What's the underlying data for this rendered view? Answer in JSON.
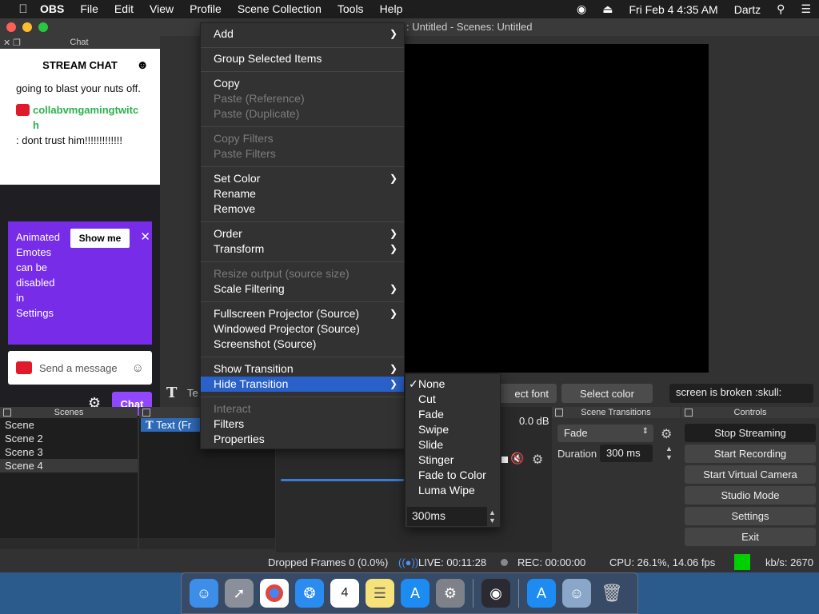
{
  "menubar": {
    "app_name": "OBS",
    "items": [
      "File",
      "Edit",
      "View",
      "Profile",
      "Scene Collection",
      "Tools",
      "Help"
    ],
    "datetime": "Fri Feb 4  4:35 AM",
    "user": "Dartz"
  },
  "window": {
    "title": ": Untitled - Scenes: Untitled"
  },
  "chat": {
    "dock_title": "Chat",
    "header": "STREAM CHAT",
    "message1": "going to blast your nuts off.",
    "username": "collabvmgamingtwitch",
    "message2": ": dont trust him!!!!!!!!!!!!!",
    "promo_text_1": "Animated",
    "promo_text_2": "Emotes",
    "promo_text_3": "can be",
    "promo_text_4": "disabled",
    "promo_text_5": "in",
    "promo_text_6": "Settings",
    "show_me": "Show me",
    "input_placeholder": "Send a message",
    "chat_button": "Chat"
  },
  "context_menu": {
    "add": "Add",
    "group": "Group Selected Items",
    "copy": "Copy",
    "paste_ref": "Paste (Reference)",
    "paste_dup": "Paste (Duplicate)",
    "copy_filters": "Copy Filters",
    "paste_filters": "Paste Filters",
    "set_color": "Set Color",
    "rename": "Rename",
    "remove": "Remove",
    "order": "Order",
    "transform": "Transform",
    "resize": "Resize output (source size)",
    "scale_filtering": "Scale Filtering",
    "fullscreen_proj": "Fullscreen Projector (Source)",
    "windowed_proj": "Windowed Projector (Source)",
    "screenshot": "Screenshot (Source)",
    "show_transition": "Show Transition",
    "hide_transition": "Hide Transition",
    "interact": "Interact",
    "filters": "Filters",
    "properties": "Properties"
  },
  "transition_submenu": {
    "items": [
      "None",
      "Cut",
      "Fade",
      "Swipe",
      "Slide",
      "Stinger",
      "Fade to Color",
      "Luma Wipe"
    ],
    "selected": "None",
    "duration": "300ms"
  },
  "source_toolbar": {
    "label": "Te",
    "select_font": "ect font",
    "select_color": "Select color",
    "text_value": "screen is broken :skull:"
  },
  "scenes": {
    "title": "Scenes",
    "items": [
      "Scene",
      "Scene 2",
      "Scene 3",
      "Scene 4"
    ],
    "selected_index": 3
  },
  "sources": {
    "title": "S",
    "item": "Text (Fr"
  },
  "mixer": {
    "db": "0.0 dB"
  },
  "transitions": {
    "title": "Scene Transitions",
    "selected": "Fade",
    "duration_label": "Duration",
    "duration": "300 ms"
  },
  "controls": {
    "title": "Controls",
    "buttons": [
      "Stop Streaming",
      "Start Recording",
      "Start Virtual Camera",
      "Studio Mode",
      "Settings",
      "Exit"
    ]
  },
  "status": {
    "dropped": "Dropped Frames 0 (0.0%)",
    "live": "LIVE: 00:11:28",
    "rec": "REC: 00:00:00",
    "cpu": "CPU: 26.1%, 14.06 fps",
    "kbs": "kb/s: 2670",
    "indicator_color": "#00d000"
  },
  "dock_apps": [
    "finder",
    "launchpad",
    "chrome",
    "safari",
    "calendar",
    "notes",
    "app-store",
    "system-preferences",
    "obs",
    "app-store-2",
    "preview",
    "trash"
  ],
  "calendar_day": "4"
}
